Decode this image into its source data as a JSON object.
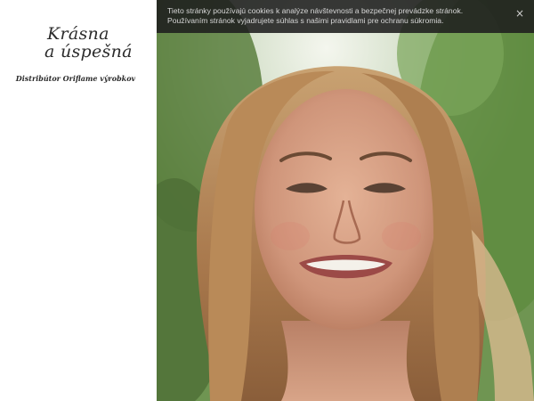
{
  "brand": {
    "logo_line1": "Krásna",
    "logo_line2": "a úspešná",
    "tagline": "Distribútor Oriflame  výrobkov"
  },
  "cookie_banner": {
    "text": "Tieto stránky používajú cookies k analýze návštevnosti a bezpečnej prevádzke stránok. Používaním stránok vyjadrujete súhlas s našimi pravidlami pre ochranu súkromia.",
    "close_symbol": "×"
  },
  "hero": {
    "icon": "hero-photo",
    "colors": {
      "foliage": "#6f9a52",
      "sky": "#e8efe6",
      "hair": "#b88a5a",
      "skin": "#d9a58a"
    }
  }
}
